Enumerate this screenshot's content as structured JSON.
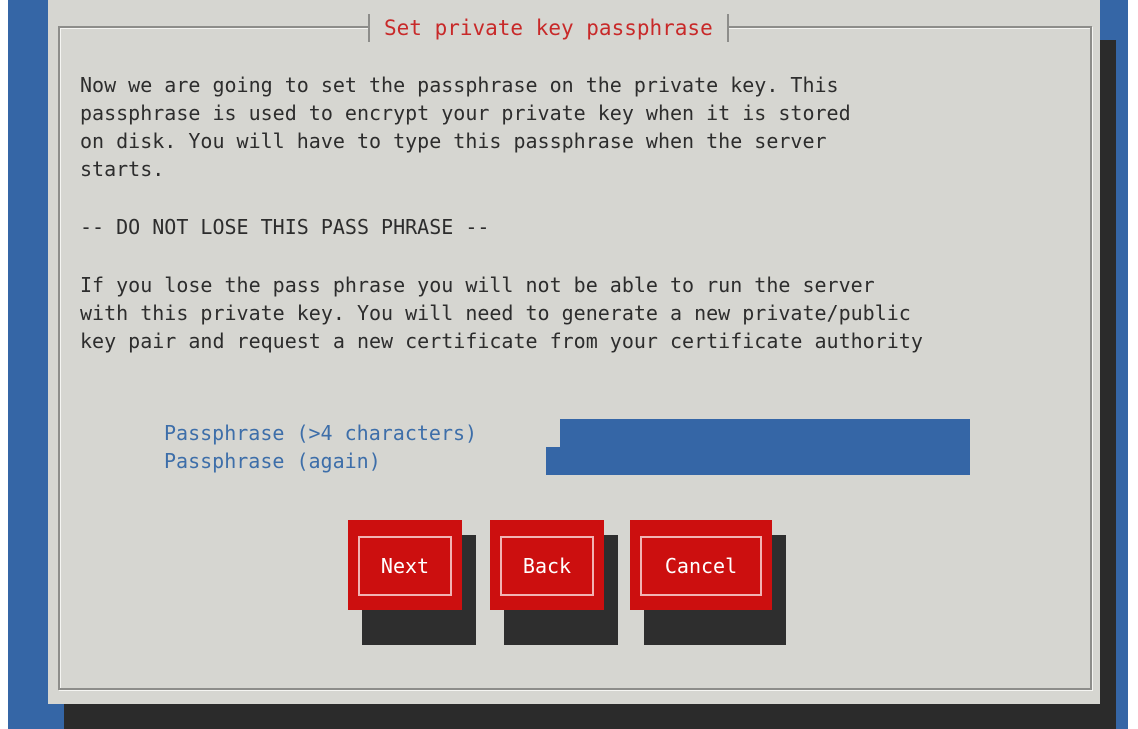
{
  "dialog": {
    "title": "Set private key passphrase",
    "paragraph1": [
      "Now we are going to set the passphrase on the private key. This",
      "passphrase is used to encrypt your private key when it is stored",
      "on disk. You will have to type this passphrase when the server",
      "starts."
    ],
    "warning": "-- DO NOT LOSE THIS PASS PHRASE --",
    "paragraph2": [
      "If you lose the pass phrase you will not be able to run the server",
      "with this private key. You will need to generate a new private/public",
      "key pair and request a new certificate from your certificate authority"
    ]
  },
  "form": {
    "passphrase_label": "Passphrase (>4 characters)",
    "passphrase_value": "",
    "passphrase_again_label": "Passphrase (again)",
    "passphrase_again_value": ""
  },
  "buttons": {
    "next": "Next",
    "back": "Back",
    "cancel": "Cancel"
  },
  "colors": {
    "background_blue": "#3566a6",
    "dialog_grey": "#d6d6d1",
    "title_red": "#c82929",
    "button_red": "#cc0f0f",
    "label_blue": "#3d6ea9"
  }
}
